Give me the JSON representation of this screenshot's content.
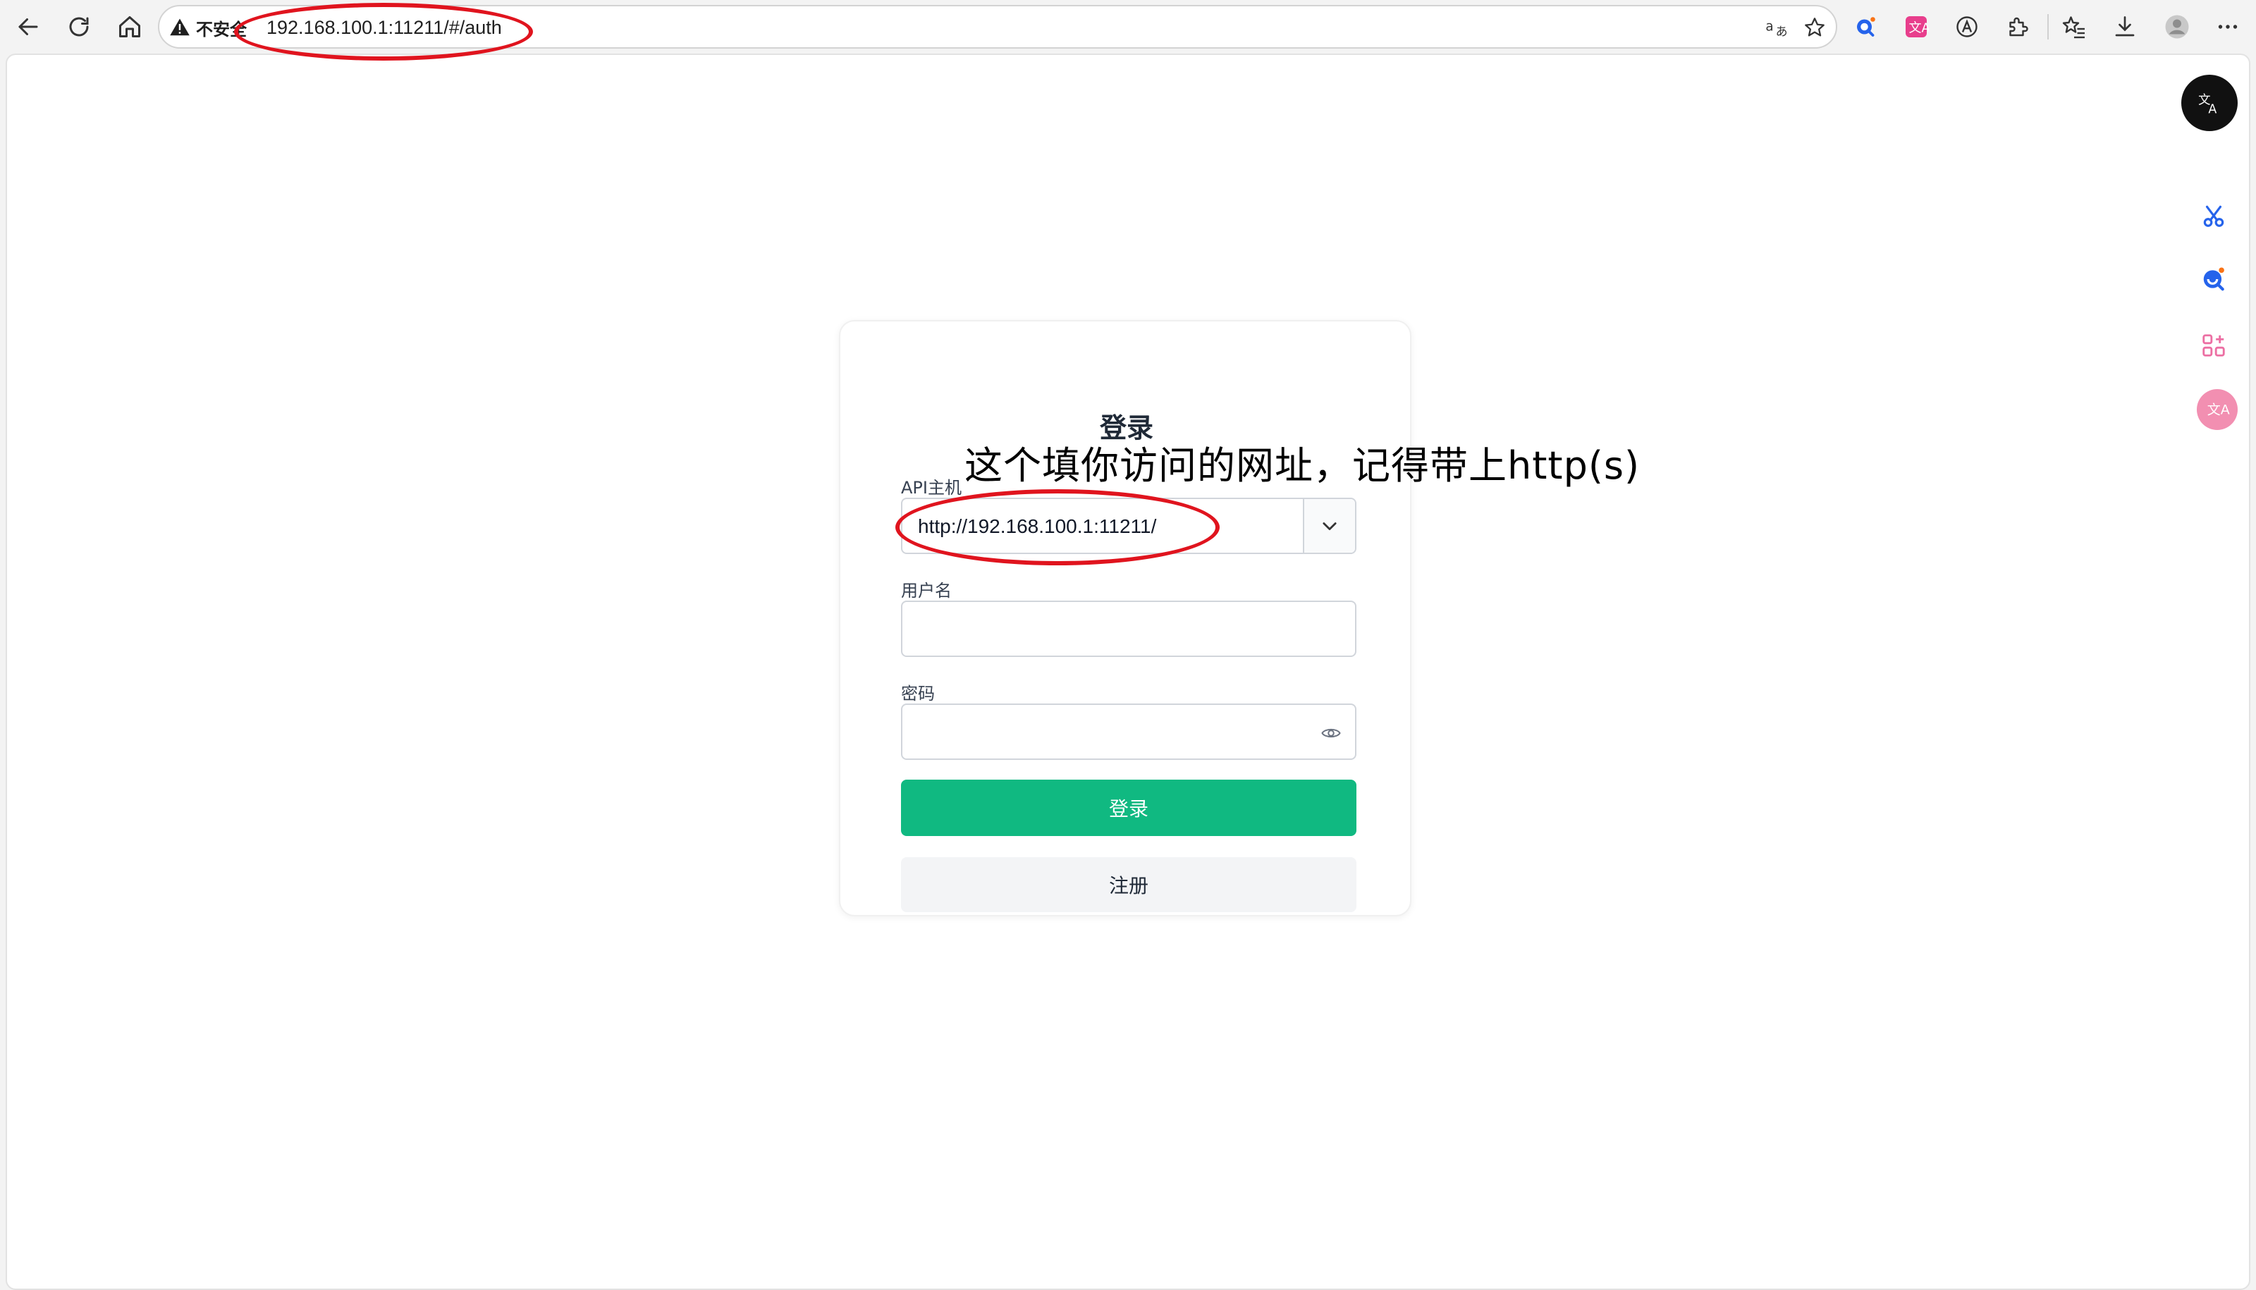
{
  "browser": {
    "security_warning": "不安全",
    "url": "192.168.100.1:11211/#/auth",
    "icons": {
      "back": "back-arrow-icon",
      "reload": "reload-icon",
      "home": "home-icon",
      "warning": "warning-triangle-icon",
      "translate": "translate-icon",
      "favorite": "star-icon",
      "extensions": [
        "search-extension-icon",
        "translate-extension-icon",
        "a-circle-icon",
        "puzzle-icon"
      ],
      "favorites_list": "favorites-icon",
      "downloads": "download-icon",
      "profile": "avatar",
      "more": "more-icon"
    }
  },
  "login": {
    "title": "登录",
    "api_host_label": "API主机",
    "api_host_value": "http://192.168.100.1:11211/",
    "username_label": "用户名",
    "username_value": "",
    "password_label": "密码",
    "password_value": "",
    "login_button": "登录",
    "register_button": "注册"
  },
  "annotation": {
    "text": "这个填你访问的网址，记得带上http(s)",
    "color": "#e0141e"
  },
  "side_panel": {
    "icons": [
      "translate-icon",
      "scissors-icon",
      "search-chat-icon",
      "apps-icon",
      "translate-pink-icon"
    ]
  },
  "colors": {
    "primary": "#10b981",
    "annotation": "#e0141e"
  }
}
